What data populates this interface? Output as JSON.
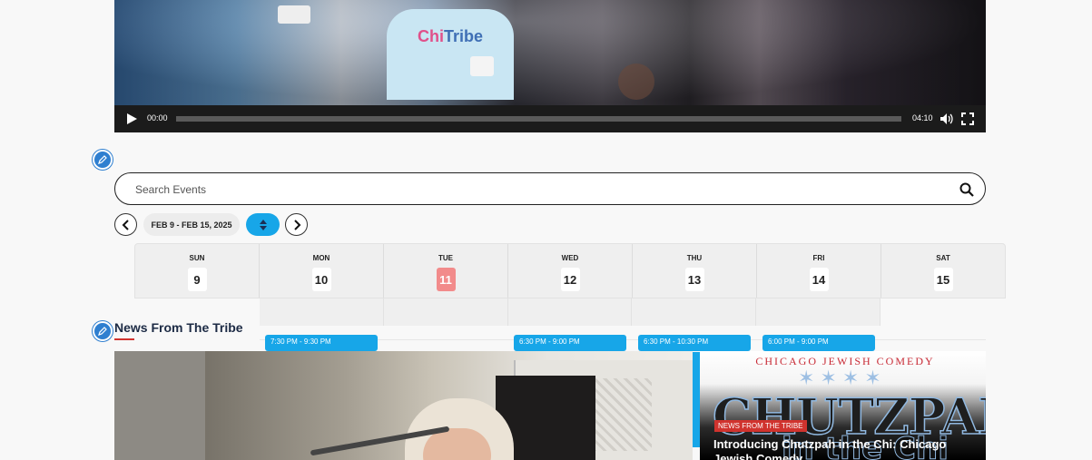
{
  "video": {
    "tee_text_a": "Chi",
    "tee_text_b": "Tribe",
    "current_time": "00:00",
    "duration": "04:10"
  },
  "search": {
    "placeholder": "Search Events"
  },
  "calendar": {
    "date_range": "FEB 9 - FEB 15, 2025",
    "days": [
      {
        "name": "SUN",
        "num": "9"
      },
      {
        "name": "MON",
        "num": "10"
      },
      {
        "name": "TUE",
        "num": "11"
      },
      {
        "name": "WED",
        "num": "12"
      },
      {
        "name": "THU",
        "num": "13"
      },
      {
        "name": "FRI",
        "num": "14"
      },
      {
        "name": "SAT",
        "num": "15"
      }
    ],
    "events": [
      {
        "time": "7:30 PM - 9:30 PM"
      },
      {
        "time": "6:30 PM - 9:00 PM"
      },
      {
        "time": "6:30 PM - 10:30 PM"
      },
      {
        "time": "6:00 PM - 9:00 PM"
      }
    ]
  },
  "news": {
    "section_title": "News From The Tribe",
    "featured": {
      "arc_text": "CHICAGO JEWISH COMEDY",
      "logo_text": "CHUTZPAH",
      "logo_text_2": "in the Chi",
      "badge": "NEWS FROM THE TRIBE",
      "headline": "Introducing Chutzpah in the Chi: Chicago Jewish Comedy"
    }
  },
  "colors": {
    "accent": "#17a6e8",
    "today": "#f28b8b",
    "news_red": "#d0332e",
    "edit": "#2f7fd0"
  }
}
